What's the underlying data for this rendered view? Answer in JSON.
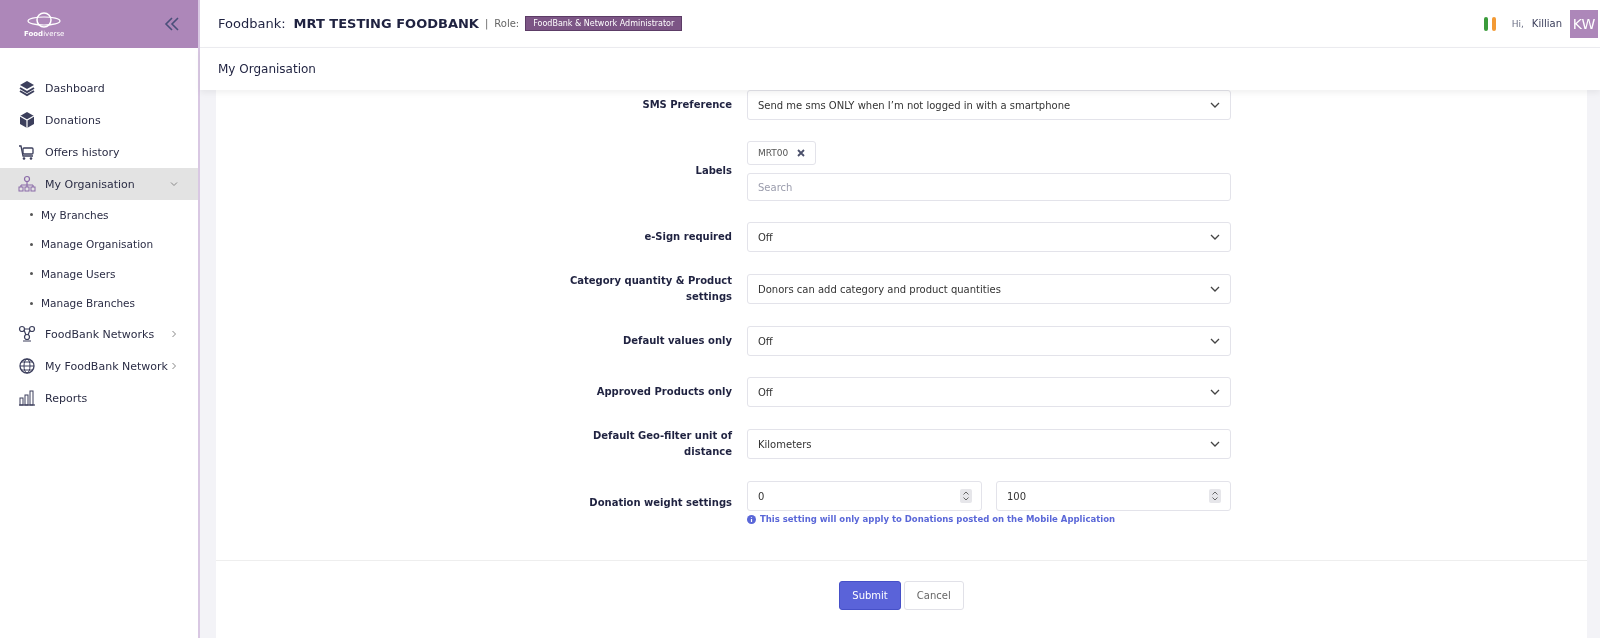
{
  "logo": {
    "text": "**Food**iverse"
  },
  "sidebar": {
    "items": [
      {
        "kind": "link",
        "label": "Dashboard",
        "selected": false
      },
      {
        "kind": "link",
        "label": "Donations",
        "selected": false
      },
      {
        "kind": "link",
        "label": "Offers history",
        "selected": false
      },
      {
        "kind": "group",
        "label": "My Organisation",
        "selected": true,
        "expanded": true,
        "children": [
          {
            "label": "My Branches",
            "selected": false
          },
          {
            "label": "Manage Organisation",
            "selected": false
          },
          {
            "label": "Manage Users",
            "selected": false
          },
          {
            "label": "Manage Branches",
            "selected": false
          }
        ]
      },
      {
        "kind": "group",
        "label": "FoodBank Networks",
        "selected": false,
        "expanded": false
      },
      {
        "kind": "group",
        "label": "My FoodBank Network",
        "selected": false,
        "expanded": false
      },
      {
        "kind": "link",
        "label": "Reports",
        "selected": false
      }
    ]
  },
  "header": {
    "foodbank_label": "Foodbank:",
    "foodbank_name": "MRT TESTING FOODBANK",
    "separator": "|",
    "role_label": "Role:",
    "role": "FoodBank & Network Administrator",
    "greeting": "Hi,",
    "user_name": "Killian",
    "avatar_initials": "KW"
  },
  "page_title": "My Organisation",
  "form": {
    "fields": [
      {
        "kind": "select",
        "label": "SMS Preference",
        "value": "Send me sms ONLY when I’m not logged in with a smartphone"
      },
      {
        "kind": "tags",
        "label": "Labels",
        "tags": [
          "MRT00"
        ],
        "placeholder": "Search"
      },
      {
        "kind": "select",
        "label": "e-Sign required",
        "value": "Off"
      },
      {
        "kind": "select",
        "label": "Category quantity & Product settings",
        "value": "Donors can add category and product quantities"
      },
      {
        "kind": "select",
        "label": "Default values only",
        "value": "Off"
      },
      {
        "kind": "select",
        "label": "Approved Products only",
        "value": "Off"
      },
      {
        "kind": "select",
        "label": "Default Geo-filter unit of distance",
        "value": "Kilometers"
      },
      {
        "kind": "number_pair",
        "label": "Donation weight settings",
        "values": [
          "0",
          "100"
        ],
        "note": "This setting will only apply to Donations posted on the Mobile Application"
      }
    ],
    "buttons": [
      {
        "kind": "primary",
        "label": "Submit"
      },
      {
        "kind": "secondary",
        "label": "Cancel"
      }
    ]
  }
}
